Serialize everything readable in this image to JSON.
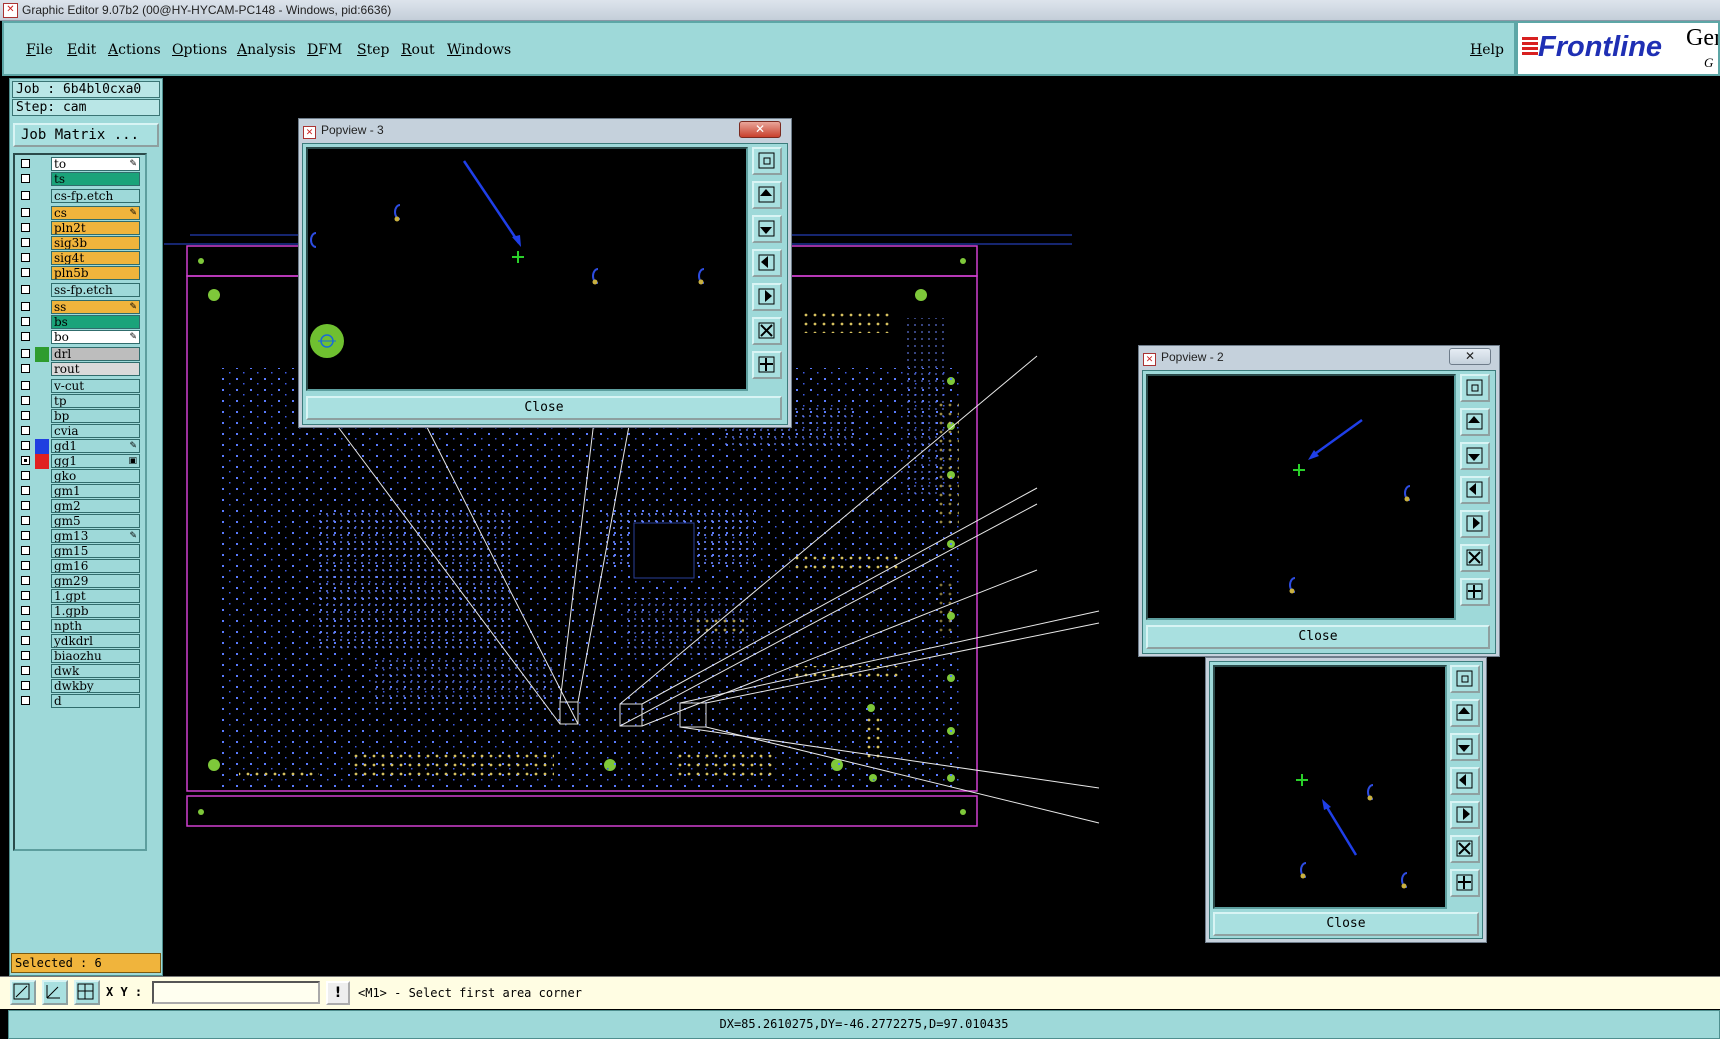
{
  "window": {
    "title": "Graphic Editor 9.07b2 (00@HY-HYCAM-PC148 - Windows, pid:6636)"
  },
  "menu": {
    "items": [
      "File",
      "Edit",
      "Actions",
      "Options",
      "Analysis",
      "DFM",
      "Step",
      "Rout",
      "Windows"
    ],
    "help": "Help"
  },
  "logo": {
    "text": "Frontline",
    "gen": "Ger",
    "gen_sub": "G"
  },
  "job": {
    "job_line": "Job : 6b4bl0cxa0",
    "step_line": "Step: cam",
    "matrix_button": "Job Matrix ..."
  },
  "layers": [
    {
      "name": "to",
      "color": "#ffffff",
      "mark": "",
      "tag": "✎",
      "checked": false
    },
    {
      "name": "ts",
      "color": "#1aa37a",
      "mark": "",
      "tag": "",
      "checked": false
    },
    {
      "name": "cs-fp.etch",
      "color": "#9ed9d9",
      "mark": "",
      "tag": "",
      "checked": false
    },
    {
      "name": "cs",
      "color": "#f0b43c",
      "mark": "",
      "tag": "✎",
      "checked": false
    },
    {
      "name": "pln2t",
      "color": "#f0b43c",
      "mark": "",
      "tag": "",
      "checked": false
    },
    {
      "name": "sig3b",
      "color": "#f0b43c",
      "mark": "",
      "tag": "",
      "checked": false
    },
    {
      "name": "sig4t",
      "color": "#f0b43c",
      "mark": "",
      "tag": "",
      "checked": false
    },
    {
      "name": "pln5b",
      "color": "#f0b43c",
      "mark": "",
      "tag": "",
      "checked": false
    },
    {
      "name": "ss-fp.etch",
      "color": "#9ed9d9",
      "mark": "",
      "tag": "",
      "checked": false
    },
    {
      "name": "ss",
      "color": "#f0b43c",
      "mark": "",
      "tag": "✎",
      "checked": false
    },
    {
      "name": "bs",
      "color": "#1aa37a",
      "mark": "",
      "tag": "",
      "checked": false
    },
    {
      "name": "bo",
      "color": "#ffffff",
      "mark": "",
      "tag": "✎",
      "checked": false
    },
    {
      "name": "drl",
      "color": "#bdbdbd",
      "mark": "#2e9c2e",
      "tag": "",
      "checked": false
    },
    {
      "name": "rout",
      "color": "#d9d9d9",
      "mark": "",
      "tag": "",
      "checked": false
    },
    {
      "name": "v-cut",
      "color": "#9ed9d9",
      "mark": "",
      "tag": "",
      "checked": false
    },
    {
      "name": "tp",
      "color": "#9ed9d9",
      "mark": "",
      "tag": "",
      "checked": false
    },
    {
      "name": "bp",
      "color": "#9ed9d9",
      "mark": "",
      "tag": "",
      "checked": false
    },
    {
      "name": "cvia",
      "color": "#9ed9d9",
      "mark": "",
      "tag": "",
      "checked": false
    },
    {
      "name": "gd1",
      "color": "#9ed9d9",
      "mark": "#1f3fe0",
      "tag": "✎",
      "checked": false
    },
    {
      "name": "gg1",
      "color": "#9ed9d9",
      "mark": "#e02020",
      "tag": "▣",
      "checked": true
    },
    {
      "name": "gko",
      "color": "#9ed9d9",
      "mark": "",
      "tag": "",
      "checked": false
    },
    {
      "name": "gm1",
      "color": "#9ed9d9",
      "mark": "",
      "tag": "",
      "checked": false
    },
    {
      "name": "gm2",
      "color": "#9ed9d9",
      "mark": "",
      "tag": "",
      "checked": false
    },
    {
      "name": "gm5",
      "color": "#9ed9d9",
      "mark": "",
      "tag": "",
      "checked": false
    },
    {
      "name": "gm13",
      "color": "#9ed9d9",
      "mark": "",
      "tag": "✎",
      "checked": false
    },
    {
      "name": "gm15",
      "color": "#9ed9d9",
      "mark": "",
      "tag": "",
      "checked": false
    },
    {
      "name": "gm16",
      "color": "#9ed9d9",
      "mark": "",
      "tag": "",
      "checked": false
    },
    {
      "name": "gm29",
      "color": "#9ed9d9",
      "mark": "",
      "tag": "",
      "checked": false
    },
    {
      "name": "1.gpt",
      "color": "#9ed9d9",
      "mark": "",
      "tag": "",
      "checked": false
    },
    {
      "name": "1.gpb",
      "color": "#9ed9d9",
      "mark": "",
      "tag": "",
      "checked": false
    },
    {
      "name": "npth",
      "color": "#9ed9d9",
      "mark": "",
      "tag": "",
      "checked": false
    },
    {
      "name": "ydkdrl",
      "color": "#9ed9d9",
      "mark": "",
      "tag": "",
      "checked": false
    },
    {
      "name": "biaozhu",
      "color": "#9ed9d9",
      "mark": "",
      "tag": "",
      "checked": false
    },
    {
      "name": "dwk",
      "color": "#9ed9d9",
      "mark": "",
      "tag": "",
      "checked": false
    },
    {
      "name": "dwkby",
      "color": "#9ed9d9",
      "mark": "",
      "tag": "",
      "checked": false
    },
    {
      "name": "d",
      "color": "#9ed9d9",
      "mark": "",
      "tag": "",
      "checked": false
    }
  ],
  "selected": "Selected : 6",
  "popviews": [
    {
      "title": "Popview - 3",
      "close_label": "Close",
      "close_x": "✕"
    },
    {
      "title": "Popview - 2",
      "close_label": "Close",
      "close_x": "✕"
    },
    {
      "title": "",
      "close_label": "Close",
      "close_x": ""
    }
  ],
  "command": {
    "xy_label": "X Y :",
    "xy_value": "",
    "excl": "!",
    "prompt": "<M1> - Select first area corner"
  },
  "status": {
    "text": "DX=85.2610275,DY=-46.2772275,D=97.010435"
  }
}
